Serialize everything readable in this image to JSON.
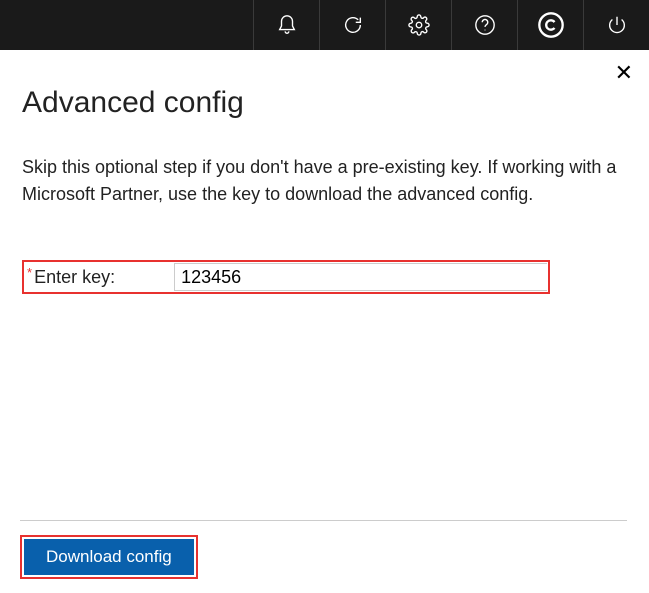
{
  "topbar": {
    "icons": [
      "bell-icon",
      "refresh-icon",
      "gear-icon",
      "help-icon",
      "copyright-icon",
      "power-icon"
    ]
  },
  "panel": {
    "title": "Advanced config",
    "description": "Skip this optional step if you don't have a pre-existing key. If working with a Microsoft Partner, use the key to download the advanced config.",
    "required_mark": "*",
    "field_label": "Enter key:",
    "field_value": "123456",
    "download_label": "Download config"
  }
}
